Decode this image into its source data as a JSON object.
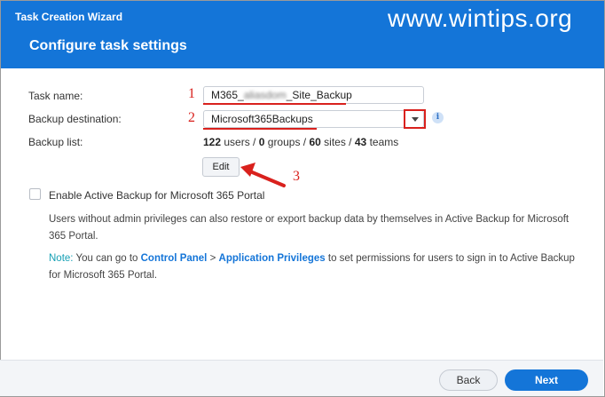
{
  "window": {
    "title": "Task Creation Wizard",
    "page_title": "Configure task settings",
    "watermark": "www.wintips.org"
  },
  "form": {
    "task_name_label": "Task name:",
    "task_name_prefix": "M365_",
    "task_name_blurred": "aliasdom",
    "task_name_suffix": "_Site_Backup",
    "backup_destination_label": "Backup destination:",
    "backup_destination_value": "Microsoft365Backups",
    "backup_list_label": "Backup list:",
    "backup_list": {
      "users_count": "122",
      "users_text": "users /",
      "groups_count": "0",
      "groups_text": "groups /",
      "sites_count": "60",
      "sites_text": "sites /",
      "teams_count": "43",
      "teams_text": "teams"
    },
    "edit_label": "Edit"
  },
  "portal": {
    "checkbox_label": "Enable Active Backup for Microsoft 365 Portal",
    "checked": false,
    "description": "Users without admin privileges can also restore or export backup data by themselves in Active Backup for Microsoft 365 Portal.",
    "note_label": "Note:",
    "note_text_1": "You can go to",
    "control_panel_link": "Control Panel",
    "separator": ">",
    "app_privileges_link": "Application Privileges",
    "note_text_2": "to set permissions for users to sign in to Active Backup for Microsoft 365 Portal."
  },
  "annotations": {
    "marker_1": "1",
    "marker_2": "2",
    "marker_3": "3",
    "color": "#d9211d"
  },
  "footer": {
    "back_label": "Back",
    "next_label": "Next"
  },
  "colors": {
    "header": "#1475d8",
    "primary_button": "#1475d8",
    "note": "#16a0b5"
  }
}
